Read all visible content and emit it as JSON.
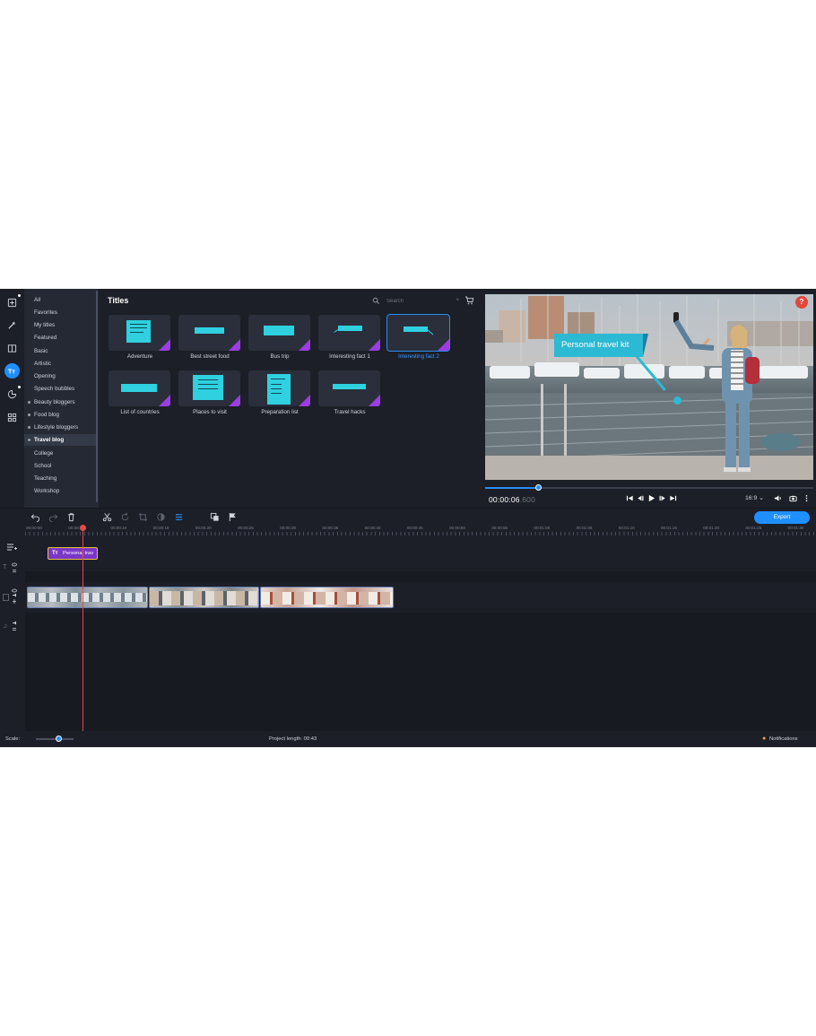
{
  "categories": [
    "All",
    "Favorites",
    "My titles",
    "Featured",
    "Basic",
    "Artistic",
    "Opening",
    "Speech bubbles",
    "Beauty bloggers",
    "Food blog",
    "Lifestyle bloggers",
    "Travel blog",
    "College",
    "School",
    "Teaching",
    "Workshop"
  ],
  "selected_category": "Travel blog",
  "titles_panel": {
    "heading": "Titles",
    "search_placeholder": "Search",
    "search_clear": "×",
    "tiles": [
      "Adventure",
      "Best street food",
      "Bus trip",
      "Interesting fact 1",
      "Interesting fact 2",
      "List of countries",
      "Places to visit",
      "Preparation list",
      "Travel hacks"
    ],
    "selected_tile": "Interesting fact 2",
    "accent_color": "#2fd0e0",
    "badge_color": "#9b3de0"
  },
  "player": {
    "help": "?",
    "overlay_text": "Personal travel kit",
    "timecode_main": "00:00:06",
    "timecode_frac": ".600",
    "progress_fraction": 0.16,
    "aspect": "16:9 ⌄"
  },
  "toolbar": {
    "export_label": "Export"
  },
  "timeline": {
    "ruler_labels": [
      "00:00:00",
      "00:00:05",
      "00:00:10",
      "00:00:15",
      "00:00:20",
      "00:00:25",
      "00:00:30",
      "00:00:35",
      "00:00:40",
      "00:00:45",
      "00:00:50",
      "00:00:55",
      "00:01:00",
      "00:01:05",
      "00:01:10",
      "00:01:15",
      "00:01:20",
      "00:01:25",
      "00:01:30"
    ],
    "title_clip_label": "Personal trav",
    "title_clip_icon": "Tт"
  },
  "status": {
    "scale_label": "Scale:",
    "project_length": "Project length:  00:43",
    "notifications": "Notifications"
  },
  "colors": {
    "accent": "#1f8fff",
    "background": "#1c1f27",
    "playhead": "#e34a4a"
  }
}
